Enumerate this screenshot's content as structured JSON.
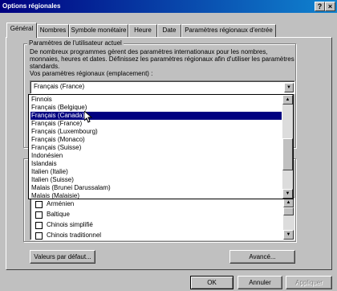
{
  "window": {
    "title": "Options régionales",
    "help_label": "?",
    "close_label": "×"
  },
  "tabs": [
    {
      "label": "Général",
      "active": true
    },
    {
      "label": "Nombres"
    },
    {
      "label": "Symbole monétaire"
    },
    {
      "label": "Heure"
    },
    {
      "label": "Date"
    },
    {
      "label": "Paramètres régionaux d'entrée"
    }
  ],
  "user_settings": {
    "group_label": "Paramètres de l'utilisateur actuel",
    "description": "De nombreux programmes gèrent des paramètres internationaux pour les nombres, monnaies, heures et dates. Définissez les paramètres régionaux afin d'utiliser les paramètres standards.",
    "locale_label": "Vos paramètres régionaux (emplacement) :",
    "locale_value": "Français (France)"
  },
  "locale_list": {
    "items": [
      "Finnois",
      "Français (Belgique)",
      "Français (Canada)",
      "Français (France)",
      "Français (Luxembourg)",
      "Français (Monaco)",
      "Français (Suisse)",
      "Indonésien",
      "Islandais",
      "Italien (Italie)",
      "Italien (Suisse)",
      "Malais (Brunei Darussalam)",
      "Malais (Malaisie)"
    ],
    "selected_index": 2
  },
  "language_list": {
    "items": [
      "Arménien",
      "Baltique",
      "Chinois simplifié",
      "Chinois traditionnel"
    ]
  },
  "buttons": {
    "defaults": "Valeurs par défaut...",
    "advanced": "Avancé...",
    "ok": "OK",
    "cancel": "Annuler",
    "apply": "Appliquer"
  },
  "icons": {
    "dropdown": "▼",
    "scroll_up": "▲",
    "scroll_down": "▼"
  }
}
